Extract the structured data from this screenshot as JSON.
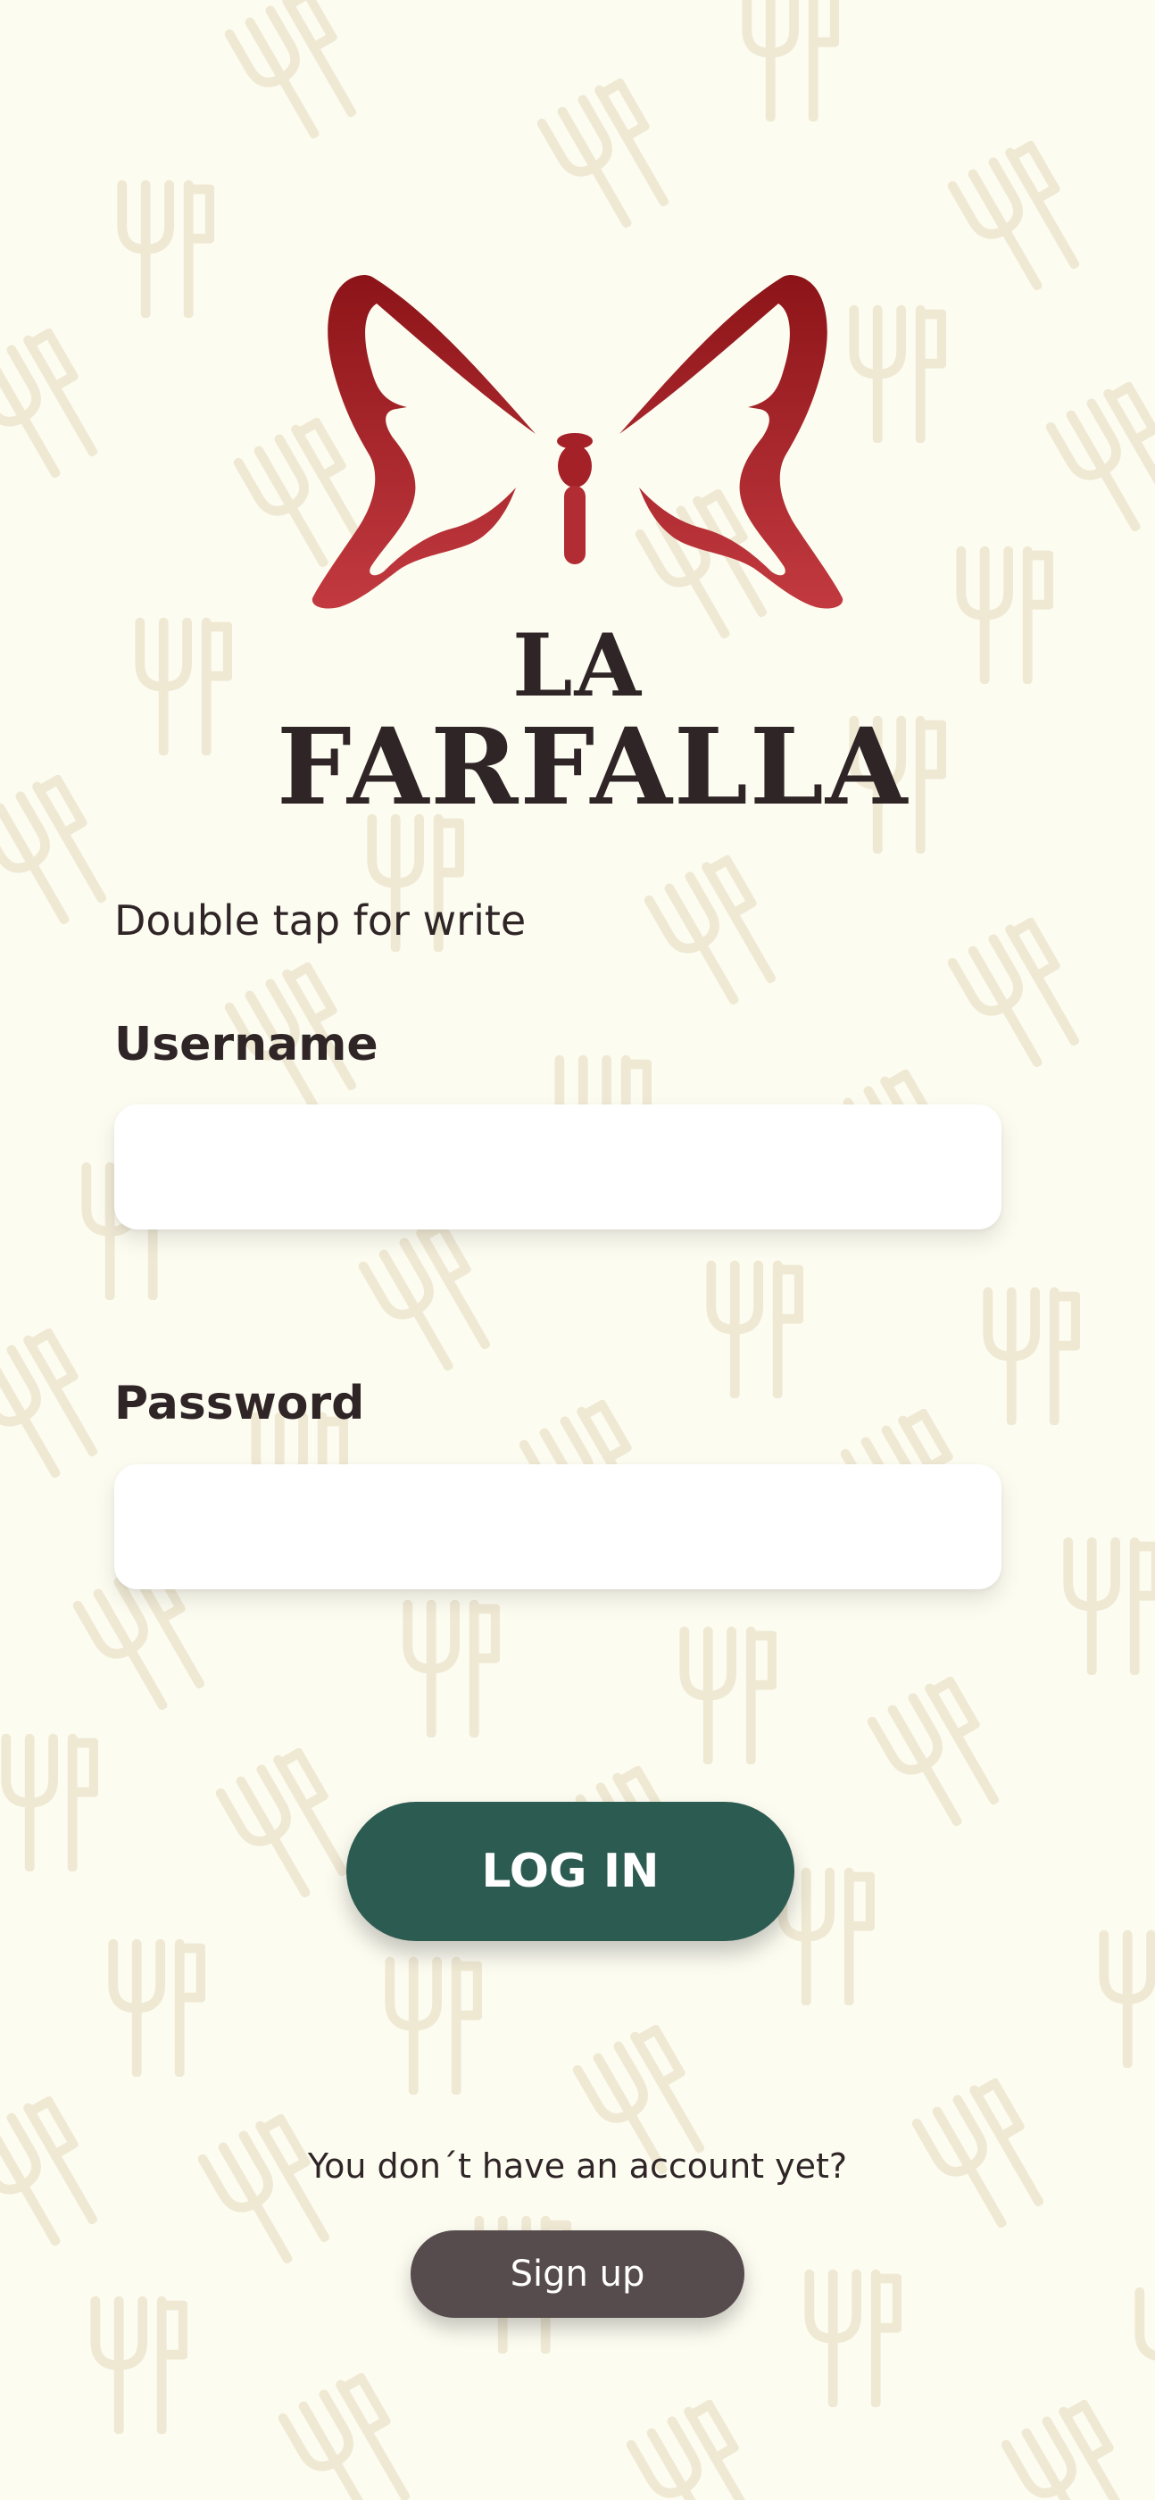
{
  "brand": {
    "line1": "LA",
    "line2": "FARFALLA",
    "logo_icon": "butterfly-logo-icon",
    "logo_color_top": "#8c1418",
    "logo_color_bottom": "#c23a40"
  },
  "background": {
    "pattern_icon": "fork-knife-icon",
    "color": "#fdfcf1",
    "pattern_color": "#efe9d4"
  },
  "form": {
    "hint": "Double tap for write",
    "username_label": "Username",
    "username_value": "",
    "password_label": "Password",
    "password_value": ""
  },
  "actions": {
    "login_label": "LOG IN",
    "login_color": "#2c5b52",
    "no_account_text": "You don´t have an account yet?",
    "signup_label": "Sign up",
    "signup_color": "#564c4d"
  }
}
